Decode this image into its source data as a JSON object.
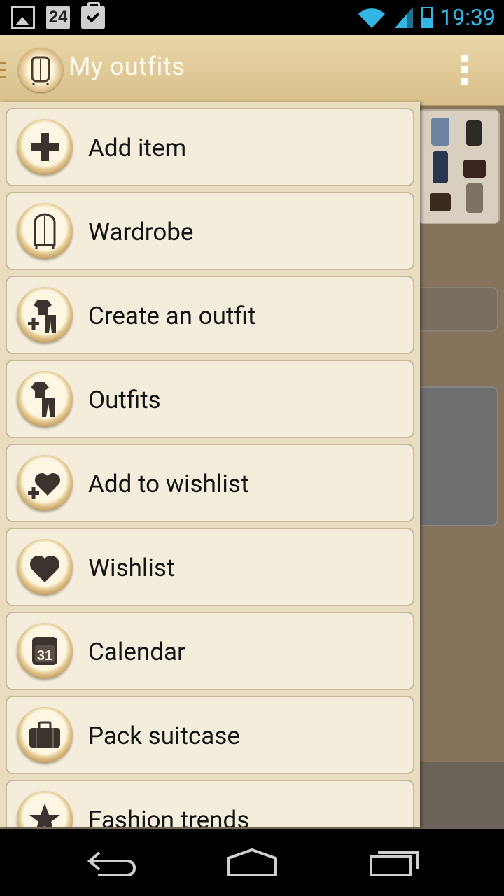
{
  "status_bar": {
    "time": "19:39",
    "notification_icons": [
      "image-icon",
      "calendar-24-icon",
      "briefcase-check-icon"
    ],
    "calendar_day": "24",
    "accent_color": "#33b5e5"
  },
  "app_bar": {
    "title": "My outfits",
    "app_icon": "wardrobe-icon",
    "overflow_icon": "overflow-menu-icon"
  },
  "drawer": {
    "items": [
      {
        "label": "Add item",
        "icon": "plus-icon"
      },
      {
        "label": "Wardrobe",
        "icon": "wardrobe-icon"
      },
      {
        "label": "Create an outfit",
        "icon": "create-outfit-icon"
      },
      {
        "label": "Outfits",
        "icon": "outfit-icon"
      },
      {
        "label": "Add to wishlist",
        "icon": "add-heart-icon"
      },
      {
        "label": "Wishlist",
        "icon": "heart-icon"
      },
      {
        "label": "Calendar",
        "icon": "calendar-icon",
        "badge": "31"
      },
      {
        "label": "Pack suitcase",
        "icon": "suitcase-icon"
      },
      {
        "label": "Fashion trends",
        "icon": "star-icon"
      }
    ]
  },
  "nav_bar": {
    "buttons": [
      "back-icon",
      "home-icon",
      "recent-apps-icon"
    ]
  }
}
